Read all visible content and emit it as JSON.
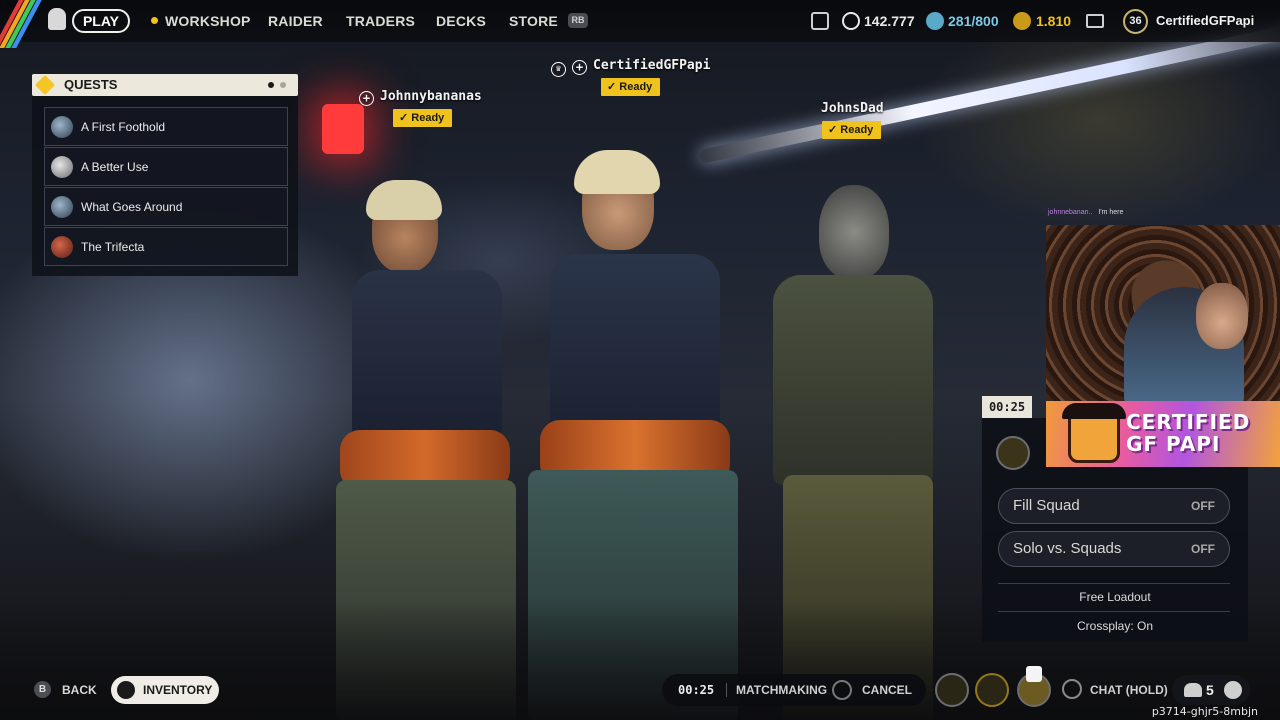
{
  "nav": {
    "play": "PLAY",
    "workshop": "WORKSHOP",
    "raider": "RAIDER",
    "traders": "TRADERS",
    "decks": "DECKS",
    "store": "STORE",
    "store_key": "RB"
  },
  "currencies": [
    {
      "icon": "coin-icon",
      "value": "142.777",
      "color": "#e9e9e9"
    },
    {
      "icon": "token-icon",
      "value": "281/800",
      "color": "#7fc7e6"
    },
    {
      "icon": "cred-icon",
      "value": "1.810",
      "color": "#f0c21e"
    }
  ],
  "profile": {
    "level": "36",
    "name": "CertifiedGFPapi"
  },
  "quests": {
    "title": "QUESTS",
    "items": [
      {
        "label": "A First Foothold"
      },
      {
        "label": "A Better Use"
      },
      {
        "label": "What Goes Around"
      },
      {
        "label": "The Trifecta"
      }
    ]
  },
  "players": [
    {
      "name": "Johnnybananas",
      "status": "Ready"
    },
    {
      "name": "CertifiedGFPapi",
      "status": "Ready"
    },
    {
      "name": "JohnsDad",
      "status": "Ready"
    }
  ],
  "match": {
    "timer": "00:25",
    "options": [
      {
        "label": "Fill Squad",
        "value": "OFF"
      },
      {
        "label": "Solo vs. Squads",
        "value": "OFF"
      }
    ],
    "loadout": "Free Loadout",
    "crossplay": "Crossplay: On"
  },
  "bottom": {
    "back_key": "B",
    "back": "BACK",
    "inventory": "INVENTORY",
    "mm_timer": "00:25",
    "matchmaking": "MATCHMAKING",
    "cancel": "CANCEL",
    "chat": "CHAT (HOLD)",
    "party_count": "5"
  },
  "stream": {
    "chat_user": "johnnebanan..",
    "chat_text": "I'm here",
    "brand": "CERTIFIED GF PAPI"
  },
  "room_code": "p3714-ghjr5-8mbjn",
  "colors": {
    "accent": "#f0c21e",
    "panel": "#0e1118",
    "ready": "#f0c21e"
  }
}
